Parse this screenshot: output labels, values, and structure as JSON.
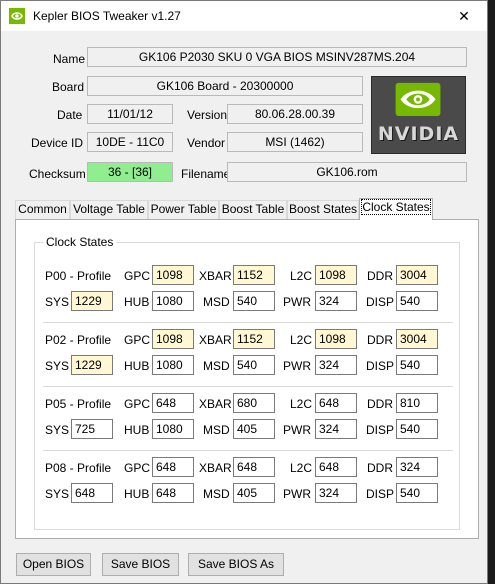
{
  "window": {
    "title": "Kepler BIOS Tweaker v1.27",
    "close_glyph": "✕"
  },
  "info": {
    "name_label": "Name",
    "name_value": "GK106 P2030 SKU 0 VGA BIOS MSINV287MS.204",
    "board_label": "Board",
    "board_value": "GK106 Board - 20300000",
    "date_label": "Date",
    "date_value": "11/01/12",
    "version_label": "Version",
    "version_value": "80.06.28.00.39",
    "device_label": "Device ID",
    "device_value": "10DE - 11C0",
    "vendor_label": "Vendor",
    "vendor_value": "MSI (1462)",
    "checksum_label": "Checksum",
    "checksum_value": "36 - [36]",
    "filename_label": "Filename",
    "filename_value": "GK106.rom"
  },
  "logo": {
    "text": "NVIDIA",
    "icon": "nvidia-eye-logo",
    "color": "#76b900"
  },
  "tabs": [
    {
      "label": "Common"
    },
    {
      "label": "Voltage Table"
    },
    {
      "label": "Power Table"
    },
    {
      "label": "Boost Table"
    },
    {
      "label": "Boost States"
    },
    {
      "label": "Clock States",
      "active": true
    }
  ],
  "clock_states": {
    "title": "Clock States",
    "row1_labels": {
      "gpc": "GPC",
      "xbar": "XBAR",
      "l2c": "L2C",
      "ddr": "DDR"
    },
    "row2_labels": {
      "sys": "SYS",
      "hub": "HUB",
      "msd": "MSD",
      "pwr": "PWR",
      "disp": "DISP"
    },
    "profiles": [
      {
        "name": "P00 - Profile",
        "gpc": "1098",
        "xbar": "1152",
        "l2c": "1098",
        "ddr": "3004",
        "sys": "1229",
        "hub": "1080",
        "msd": "540",
        "pwr": "324",
        "disp": "540",
        "highlight": true
      },
      {
        "name": "P02 - Profile",
        "gpc": "1098",
        "xbar": "1152",
        "l2c": "1098",
        "ddr": "3004",
        "sys": "1229",
        "hub": "1080",
        "msd": "540",
        "pwr": "324",
        "disp": "540",
        "highlight": true
      },
      {
        "name": "P05 - Profile",
        "gpc": "648",
        "xbar": "680",
        "l2c": "648",
        "ddr": "810",
        "sys": "725",
        "hub": "1080",
        "msd": "405",
        "pwr": "324",
        "disp": "540",
        "highlight": false
      },
      {
        "name": "P08 - Profile",
        "gpc": "648",
        "xbar": "648",
        "l2c": "648",
        "ddr": "324",
        "sys": "648",
        "hub": "648",
        "msd": "405",
        "pwr": "324",
        "disp": "540",
        "highlight": false
      }
    ]
  },
  "buttons": {
    "open": "Open BIOS",
    "save": "Save BIOS",
    "save_as": "Save BIOS As"
  },
  "colors": {
    "checksum_ok": "#90ee90",
    "highlight_field": "#fff8d2"
  }
}
